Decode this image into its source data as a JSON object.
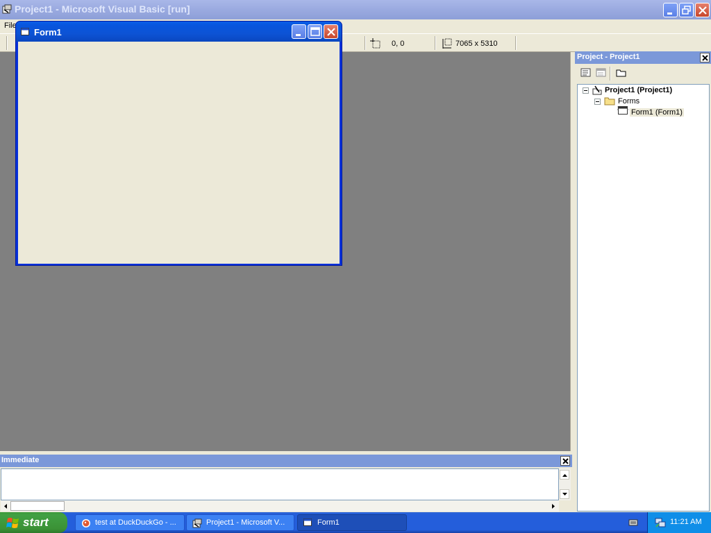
{
  "ide": {
    "title": "Project1 - Microsoft Visual Basic [run]",
    "menu_file": "File"
  },
  "toolbar": {
    "position_readout": "0, 0",
    "size_readout": "7065 x 5310"
  },
  "form1": {
    "title": "Form1"
  },
  "project_explorer": {
    "title": "Project - Project1",
    "tree": {
      "project": "Project1 (Project1)",
      "folder": "Forms",
      "form": "Form1 (Form1)"
    }
  },
  "immediate": {
    "title": "Immediate"
  },
  "taskbar": {
    "start_label": "start",
    "tasks": [
      {
        "label": "test at DuckDuckGo - ..."
      },
      {
        "label": "Project1 - Microsoft V..."
      },
      {
        "label": "Form1"
      }
    ],
    "clock": "11:21 AM"
  },
  "colors": {
    "mdi_background": "#808080",
    "xp_blue": "#0831d9",
    "taskbar_blue": "#245edb",
    "start_green": "#41a043"
  },
  "icons": [
    "vb-app-icon",
    "minimize-icon",
    "restore-icon",
    "maximize-icon",
    "close-icon",
    "form-icon",
    "folder-icon",
    "project-icon",
    "windows-flag-icon",
    "duckduckgo-icon",
    "network-icon",
    "keyboard-icon"
  ]
}
